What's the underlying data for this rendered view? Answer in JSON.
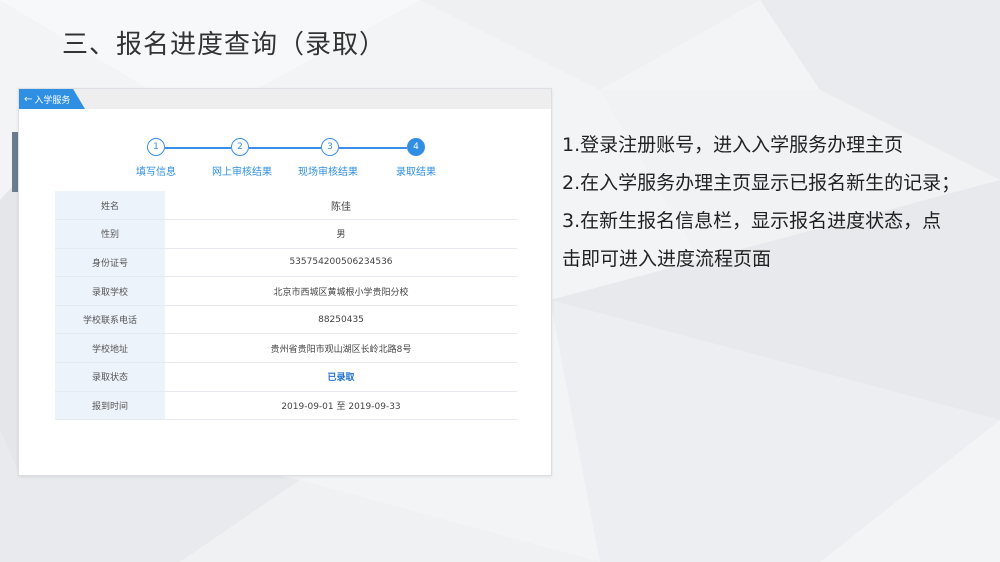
{
  "slide": {
    "title": "三、报名进度查询（录取）"
  },
  "panel": {
    "back_label": "入学服务",
    "steps": [
      {
        "number": "1",
        "label": "填写信息"
      },
      {
        "number": "2",
        "label": "网上审核结果"
      },
      {
        "number": "3",
        "label": "现场审核结果"
      },
      {
        "number": "4",
        "label": "录取结果"
      }
    ],
    "rows": [
      {
        "key": "姓名",
        "value": "陈佳"
      },
      {
        "key": "性别",
        "value": "男"
      },
      {
        "key": "身份证号",
        "value": "535754200506234536"
      },
      {
        "key": "录取学校",
        "value": "北京市西城区黄城根小学贵阳分校"
      },
      {
        "key": "学校联系电话",
        "value": "88250435"
      },
      {
        "key": "学校地址",
        "value": "贵州省贵阳市观山湖区长岭北路8号"
      },
      {
        "key": "录取状态",
        "value": "已录取"
      },
      {
        "key": "报到时间",
        "value": "2019-09-01 至 2019-09-33"
      }
    ]
  },
  "description": [
    "1.登录注册账号，进入入学服务办理主页",
    "2.在入学服务办理主页显示已报名新生的记录；",
    "3.在新生报名信息栏，显示报名进度状态，点",
    "击即可进入进度流程页面"
  ],
  "colors": {
    "accent": "#2f8fe3",
    "status": "#1f6fd1"
  },
  "icons": {
    "back": "arrow-left-icon"
  }
}
